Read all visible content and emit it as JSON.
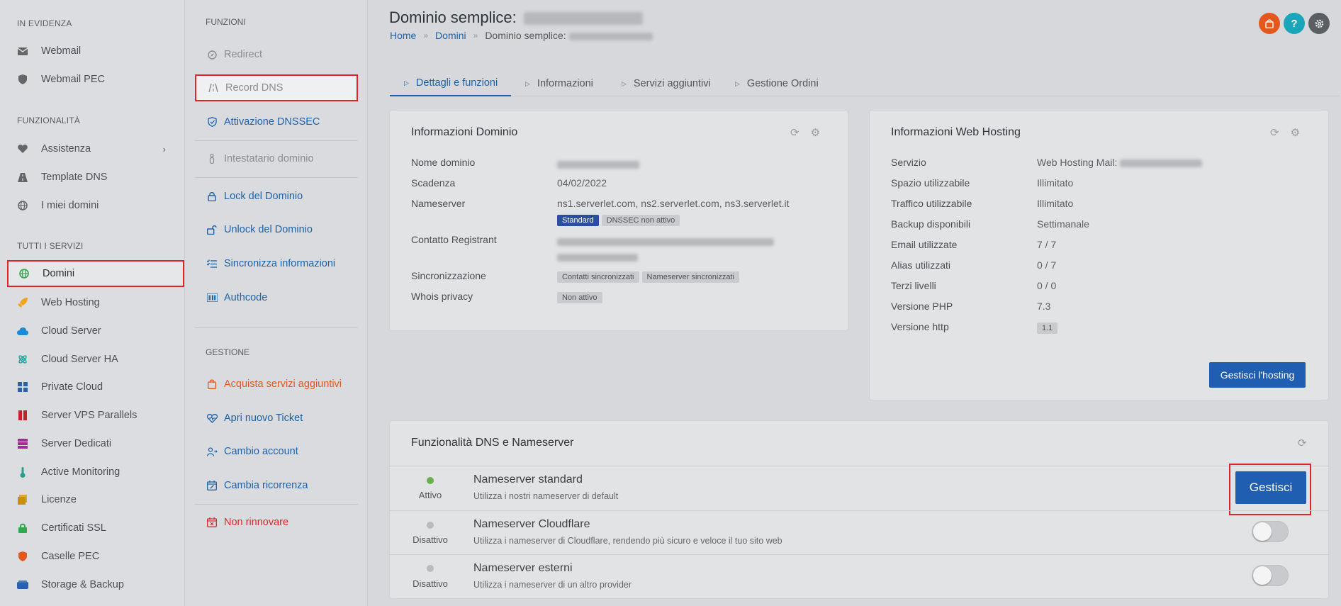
{
  "sidebar": {
    "sections": [
      "IN EVIDENZA",
      "FUNZIONALITÀ",
      "TUTTI I SERVIZI"
    ],
    "evidenza": [
      {
        "label": "Webmail",
        "icon": "envelope-icon"
      },
      {
        "label": "Webmail PEC",
        "icon": "shield-icon"
      }
    ],
    "funzionalita": [
      {
        "label": "Assistenza",
        "icon": "heart-icon"
      },
      {
        "label": "Template DNS",
        "icon": "road-icon"
      },
      {
        "label": "I miei domini",
        "icon": "globe-icon"
      }
    ],
    "servizi": [
      {
        "label": "Domini",
        "icon": "globe-icon",
        "color": "#2fa84f"
      },
      {
        "label": "Web Hosting",
        "icon": "rocket-icon",
        "color": "#f2a21b"
      },
      {
        "label": "Cloud Server",
        "icon": "cloud-icon",
        "color": "#1f8ad6"
      },
      {
        "label": "Cloud Server HA",
        "icon": "atom-icon",
        "color": "#1aa6a0"
      },
      {
        "label": "Private Cloud",
        "icon": "grid-icon",
        "color": "#2b5fb0"
      },
      {
        "label": "Server VPS Parallels",
        "icon": "parallels-icon",
        "color": "#c8202a"
      },
      {
        "label": "Server Dedicati",
        "icon": "server-icon",
        "color": "#9c2f8f"
      },
      {
        "label": "Active Monitoring",
        "icon": "thermometer-icon",
        "color": "#2a9e8e"
      },
      {
        "label": "Licenze",
        "icon": "license-icon",
        "color": "#e0a82a"
      },
      {
        "label": "Certificati SSL",
        "icon": "lock-icon",
        "color": "#2fa84f"
      },
      {
        "label": "Caselle PEC",
        "icon": "shield-icon",
        "color": "#e5581d"
      },
      {
        "label": "Storage & Backup",
        "icon": "storage-icon",
        "color": "#2b5fb0"
      }
    ]
  },
  "functions": {
    "section_funzioni": "FUNZIONI",
    "section_gestione": "GESTIONE",
    "items": [
      {
        "label": "Redirect",
        "icon": "compass-icon"
      },
      {
        "label": "Record DNS",
        "icon": "road-icon"
      },
      {
        "label": "Attivazione DNSSEC",
        "icon": "shield-check-icon"
      },
      {
        "label": "Intestatario dominio",
        "icon": "person-icon"
      },
      {
        "label": "Lock del Dominio",
        "icon": "lock-icon"
      },
      {
        "label": "Unlock del Dominio",
        "icon": "unlock-icon"
      },
      {
        "label": "Sincronizza informazioni",
        "icon": "list-check-icon"
      },
      {
        "label": "Authcode",
        "icon": "barcode-icon"
      }
    ],
    "gestione": [
      {
        "label": "Acquista servizi aggiuntivi",
        "icon": "bag-icon"
      },
      {
        "label": "Apri nuovo Ticket",
        "icon": "heart-icon"
      },
      {
        "label": "Cambio account",
        "icon": "account-icon"
      },
      {
        "label": "Cambia ricorrenza",
        "icon": "calendar-edit-icon"
      },
      {
        "label": "Non rinnovare",
        "icon": "calendar-x-icon"
      }
    ]
  },
  "header": {
    "title_prefix": "Dominio semplice:",
    "breadcrumb": [
      "Home",
      "Domini",
      "Dominio semplice:"
    ],
    "top_icons": [
      {
        "icon": "bag-icon",
        "color": "#e5581d"
      },
      {
        "icon": "help-icon",
        "glyph": "?",
        "color": "#1aa6b8"
      },
      {
        "icon": "gear-icon",
        "color": "#5b5f64"
      }
    ]
  },
  "tabs": [
    "Dettagli e funzioni",
    "Informazioni",
    "Servizi aggiuntivi",
    "Gestione Ordini"
  ],
  "domain_info": {
    "title": "Informazioni Dominio",
    "labels": [
      "Nome dominio",
      "Scadenza",
      "Nameserver",
      "Contatto Registrant",
      "Sincronizzazione",
      "Whois privacy"
    ],
    "scadenza": "04/02/2022",
    "nameserver": "ns1.serverlet.com, ns2.serverlet.com, ns3.serverlet.it",
    "ns_badges": [
      "Standard",
      "DNSSEC non attivo"
    ],
    "sync_badges": [
      "Contatti sincronizzati",
      "Nameserver sincronizzati"
    ],
    "whois_badge": "Non attivo"
  },
  "hosting_info": {
    "title": "Informazioni Web Hosting",
    "rows": [
      {
        "label": "Servizio",
        "value": "Web Hosting Mail:"
      },
      {
        "label": "Spazio utilizzabile",
        "value": "Illimitato"
      },
      {
        "label": "Traffico utilizzabile",
        "value": "Illimitato"
      },
      {
        "label": "Backup disponibili",
        "value": "Settimanale"
      },
      {
        "label": "Email utilizzate",
        "value": "7 / 7"
      },
      {
        "label": "Alias utilizzati",
        "value": "0 / 7"
      },
      {
        "label": "Terzi livelli",
        "value": "0 / 0"
      },
      {
        "label": "Versione PHP",
        "value": "7.3"
      },
      {
        "label": "Versione http",
        "value": "1.1"
      }
    ],
    "button": "Gestisci l'hosting"
  },
  "dns": {
    "title": "Funzionalità DNS e Nameserver",
    "rows": [
      {
        "state": "Attivo",
        "name": "Nameserver standard",
        "desc": "Utilizza i nostri nameserver di default",
        "dot_color": "#6ab04c"
      },
      {
        "state": "Disattivo",
        "name": "Nameserver Cloudflare",
        "desc": "Utilizza i nameserver di Cloudflare, rendendo più sicuro e veloce il tuo sito web",
        "dot_color": "#b9bbbe"
      },
      {
        "state": "Disattivo",
        "name": "Nameserver esterni",
        "desc": "Utilizza i nameserver di un altro provider",
        "dot_color": "#b9bbbe"
      }
    ],
    "manage_button": "Gestisci"
  }
}
